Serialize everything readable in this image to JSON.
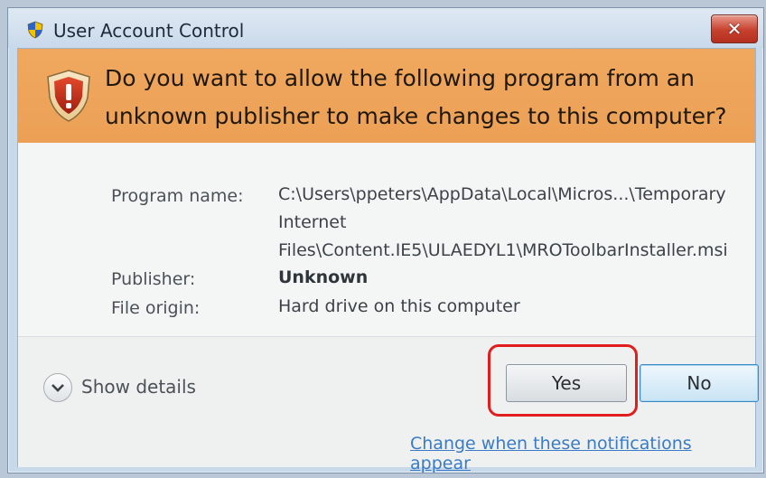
{
  "window": {
    "title": "User Account Control",
    "close_label": "✕"
  },
  "banner": {
    "question": "Do you want to allow the following program from an unknown publisher to make changes to this computer?"
  },
  "details": {
    "rows": [
      {
        "label": "Program name:",
        "value_lines": [
          "C:\\Users\\ppeters\\AppData\\Local\\Micros...\\Temporary",
          "Internet",
          "Files\\Content.IE5\\ULAEDYL1\\MROToolbarInstaller.msi"
        ]
      },
      {
        "label": "Publisher:",
        "value": "Unknown"
      },
      {
        "label": "File origin:",
        "value": "Hard drive on this computer"
      }
    ]
  },
  "footer": {
    "show_details_label": "Show details",
    "yes_label": "Yes",
    "no_label": "No",
    "change_link": "Change when these notifications appear"
  },
  "colors": {
    "banner": "#eba055",
    "highlight": "#e01e1e",
    "link": "#3a7bc6"
  },
  "icons": {
    "title": "uac-shield-icon",
    "banner": "warning-shield-icon",
    "details": "chevron-down-icon",
    "close": "close-icon"
  }
}
